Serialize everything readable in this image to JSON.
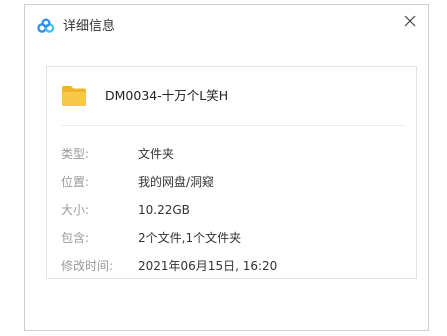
{
  "dialog": {
    "title": "详细信息",
    "logo_icon": "cloud-logo-icon",
    "close_icon": "close-icon"
  },
  "file": {
    "icon": "folder-icon",
    "name": "DM0034-十万个L笑H"
  },
  "details": [
    {
      "label": "类型:",
      "value": "文件夹"
    },
    {
      "label": "位置:",
      "value": "我的网盘/洞窥"
    },
    {
      "label": "大小:",
      "value": "10.22GB"
    },
    {
      "label": "包含:",
      "value": "2个文件,1个文件夹"
    },
    {
      "label": "修改时间:",
      "value": "2021年06月15日, 16:20"
    }
  ],
  "colors": {
    "folder": "#f8c84a",
    "logo_blue": "#2b8ef0",
    "logo_cyan": "#3bc4e8",
    "label": "#9a9a9a",
    "value": "#333333"
  }
}
